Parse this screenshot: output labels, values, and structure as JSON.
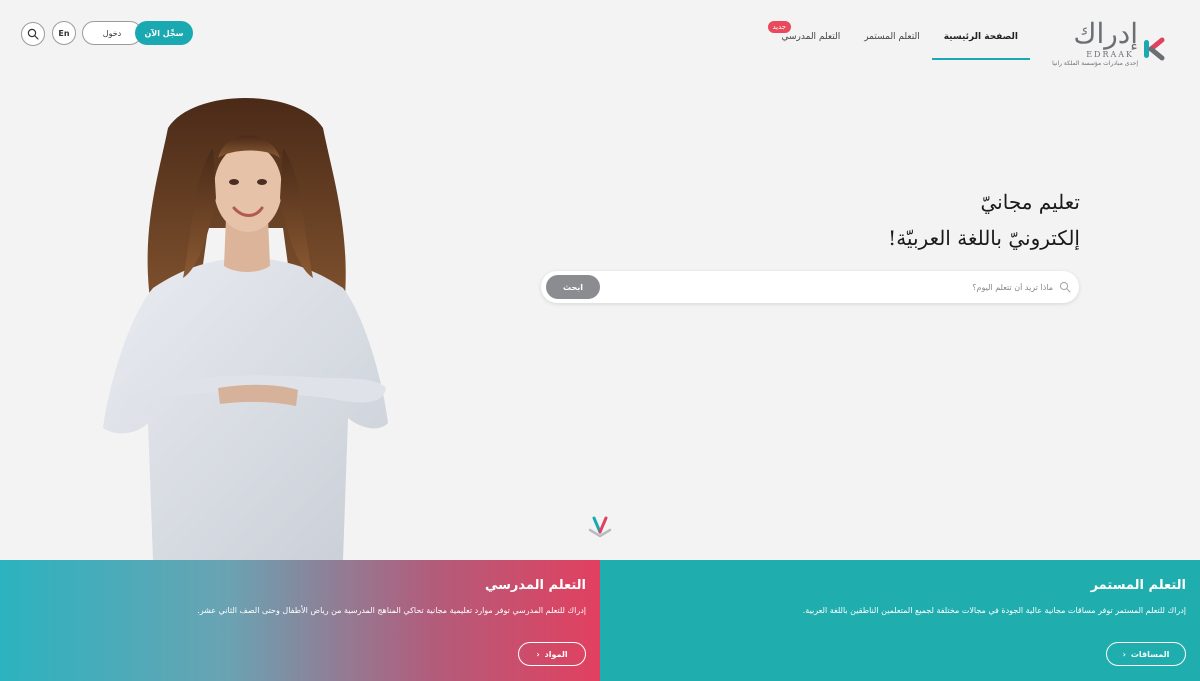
{
  "brand": {
    "name_ar": "إدراك",
    "name_latin": "EDRAAK",
    "tagline": "إحدى مبادرات مؤسسة الملكة رانيا",
    "colors": {
      "teal": "#1aa9b1",
      "pink": "#e2405f",
      "gray": "#6b6e73"
    }
  },
  "nav": {
    "items": [
      {
        "label": "الصفحة الرئيسية",
        "active": true
      },
      {
        "label": "التعلم المستمر",
        "active": false
      },
      {
        "label": "التعلم المدرسي",
        "active": false,
        "badge": "جديد"
      }
    ]
  },
  "header_actions": {
    "search_icon": "search-icon",
    "lang": "En",
    "login": "دخول",
    "signup": "سجِّل الآن"
  },
  "hero": {
    "title_line1": "تعليم مجانيّ",
    "title_line2": "إلكترونيّ باللغة العربيّة!",
    "search": {
      "placeholder": "ماذا تريد أن تتعلم اليوم؟",
      "button": "ابحث"
    }
  },
  "panels": {
    "continuous": {
      "title": "التعلم المستمر",
      "desc": "إدراك للتعلم المستمر توفر مساقات مجانية عالية الجودة في مجالات مختلفة لجميع المتعلمين الناطقين باللغة العربية.",
      "button": "المساقات"
    },
    "school": {
      "title": "التعلم المدرسي",
      "desc": "إدراك للتعلم المدرسي توفر موارد تعليمية مجانية تحاكي المناهج المدرسية من رياض الأطفال وحتى الصف الثاني عشر.",
      "button": "المواد"
    }
  }
}
